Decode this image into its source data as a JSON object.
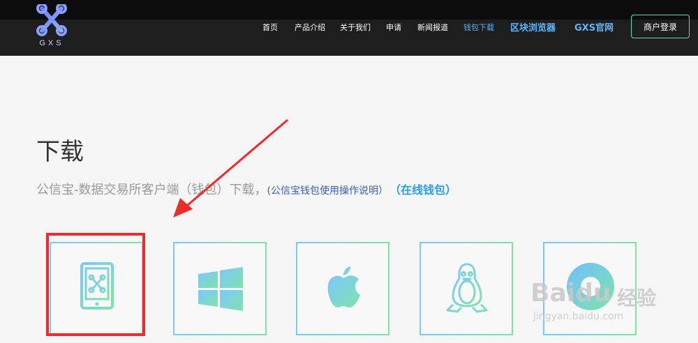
{
  "header": {
    "logo_text": "GXS",
    "nav": [
      {
        "label": "首页"
      },
      {
        "label": "产品介绍"
      },
      {
        "label": "关于我们"
      },
      {
        "label": "申请"
      },
      {
        "label": "新闻报道"
      },
      {
        "label": "钱包下载",
        "active": true
      },
      {
        "label": "区块浏览器",
        "big": true
      },
      {
        "label": "GXS官网",
        "big": true
      }
    ],
    "login_label": "商户登录"
  },
  "main": {
    "title": "下载",
    "subtitle": "公信宝-数据交易所客户端（钱包）下载，",
    "guide_link": "(公信宝钱包使用操作说明）",
    "online_wallet": "（在线钱包）"
  },
  "cards": [
    {
      "icon": "mobile-icon"
    },
    {
      "icon": "windows-icon"
    },
    {
      "icon": "apple-icon"
    },
    {
      "icon": "linux-icon"
    },
    {
      "icon": "other-platform-icon"
    }
  ],
  "watermark": {
    "brand": "Baidu",
    "cn": "经验",
    "url": "jingyan.baidu.com"
  },
  "colors": {
    "accent": "#4fb6ff",
    "header_bg": "#1e1e1e",
    "highlight": "#ee2a2a",
    "gradient_start": "#7cc7ff",
    "gradient_end": "#7fe3a8"
  }
}
